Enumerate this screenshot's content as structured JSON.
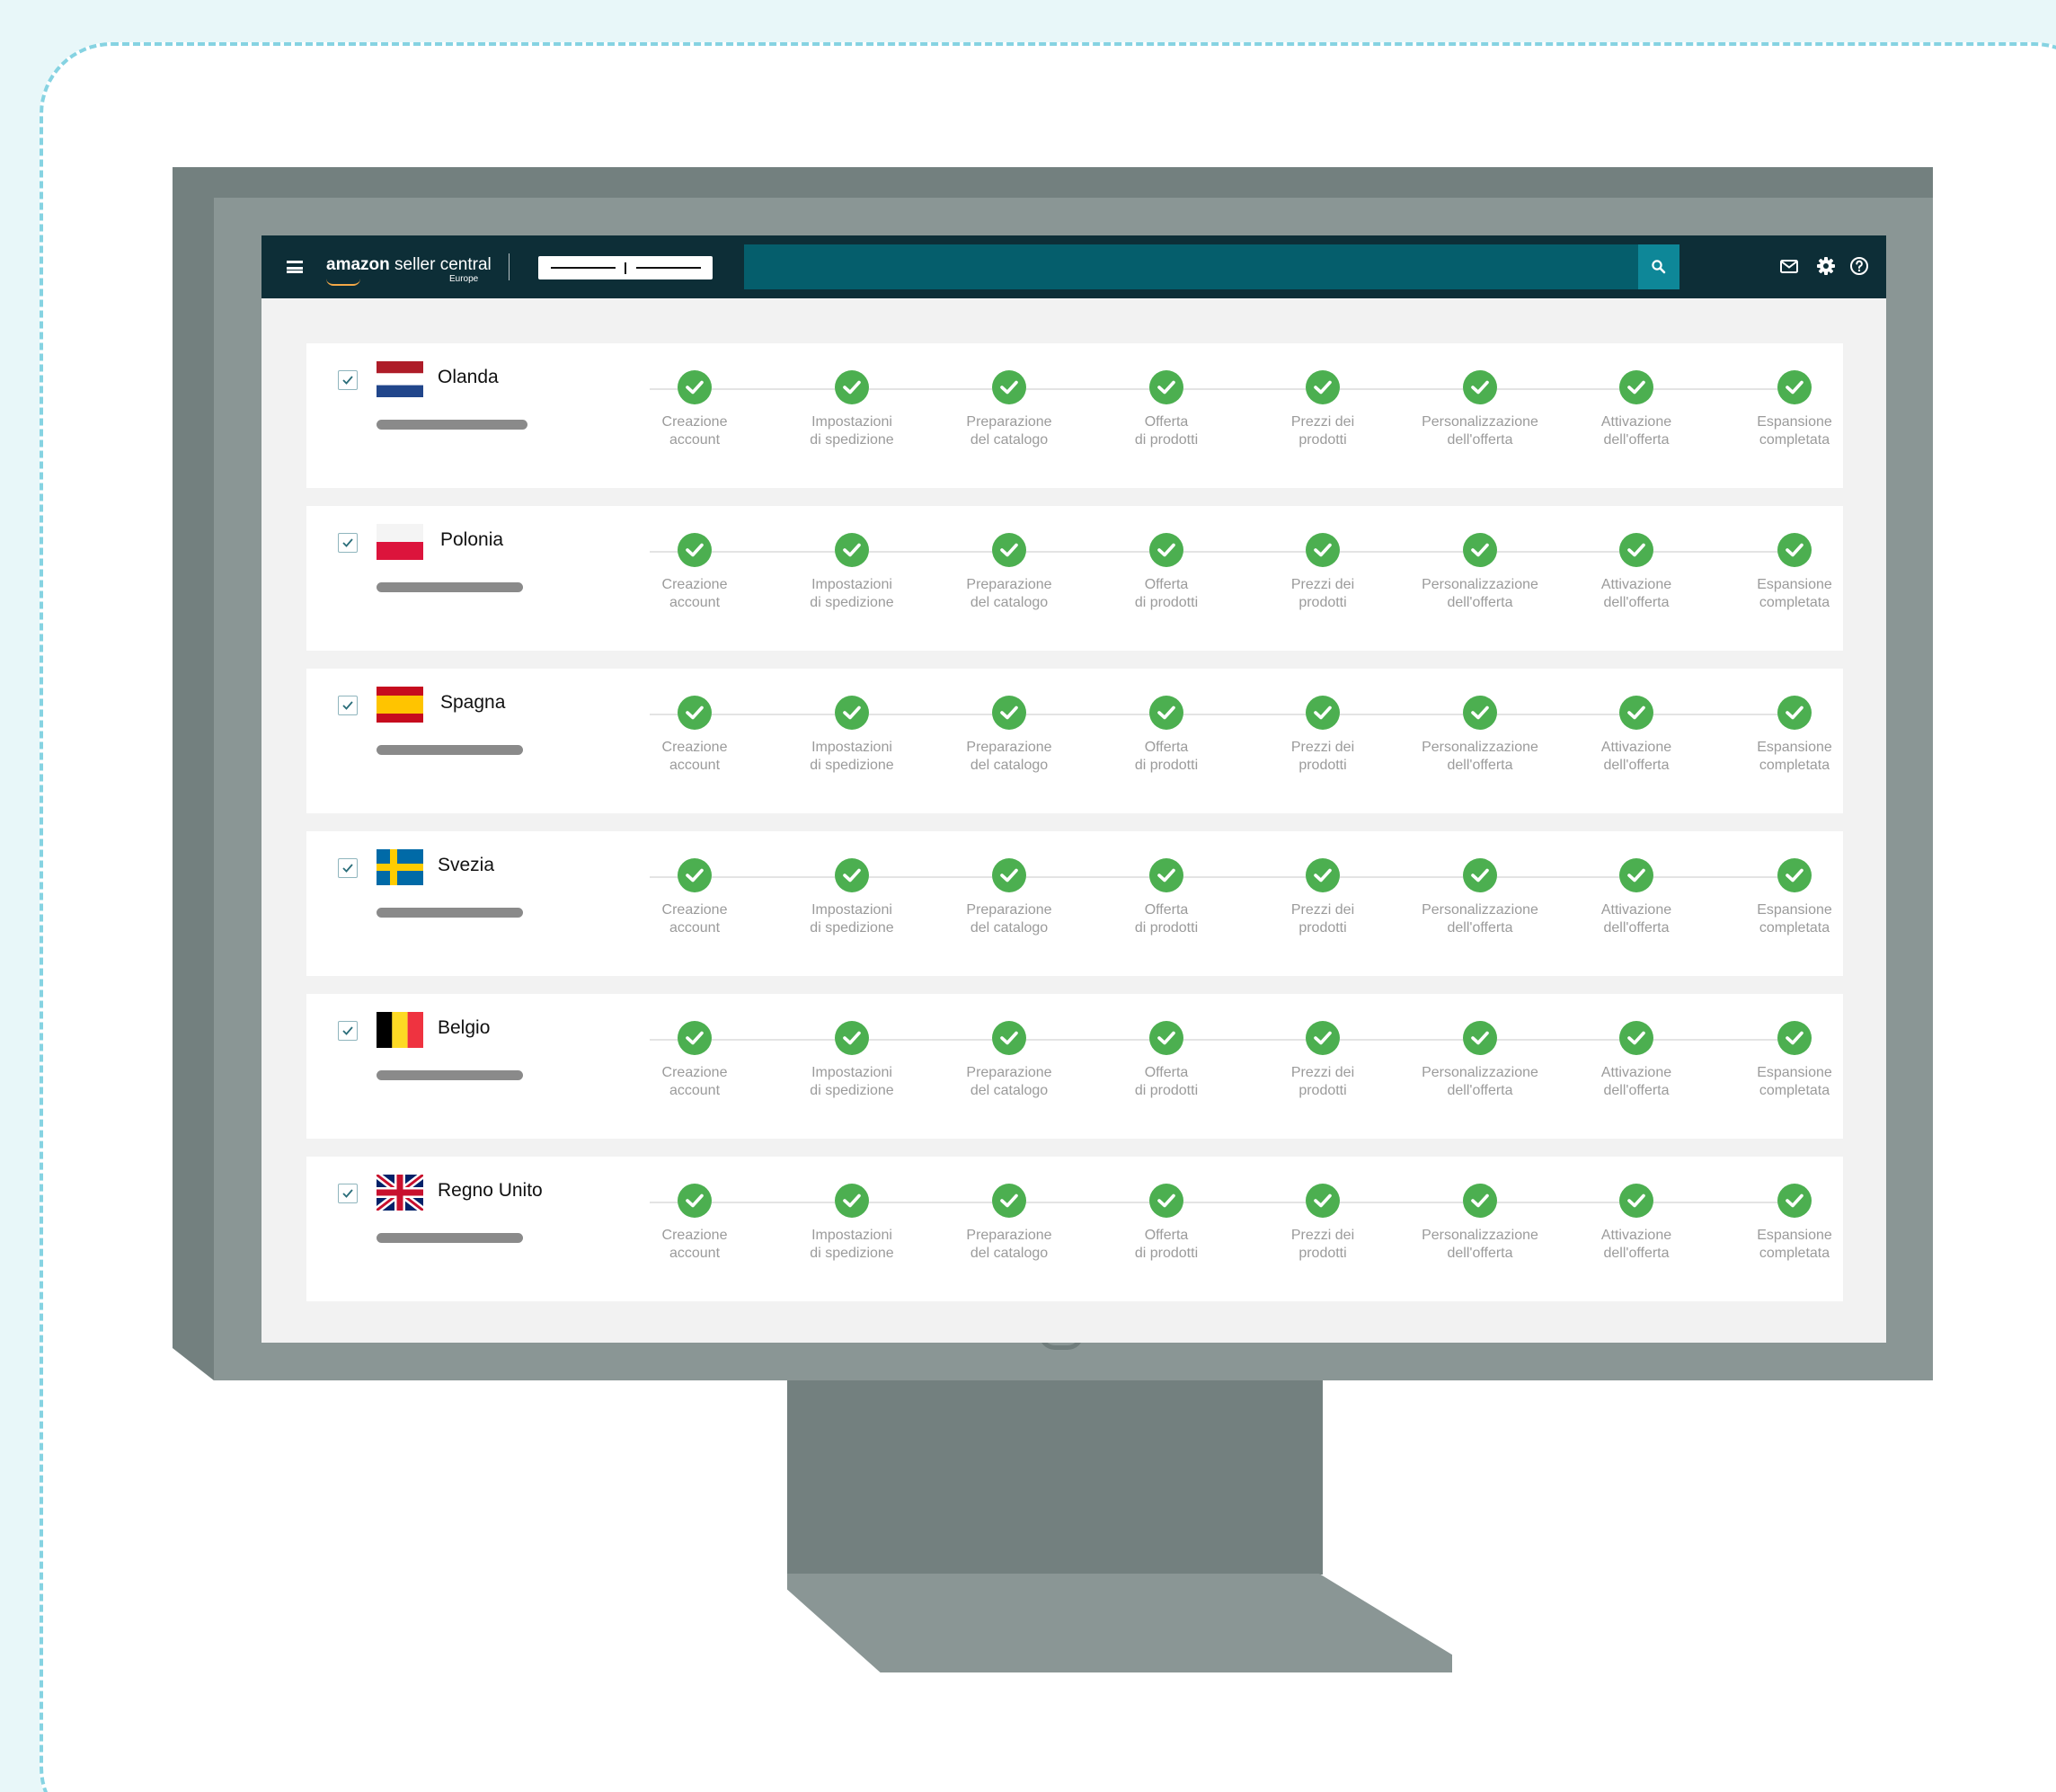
{
  "app": {
    "brand": "amazon",
    "product": " seller central",
    "region": "Europe"
  },
  "steps": [
    {
      "line1": "Creazione",
      "line2": "account"
    },
    {
      "line1": "Impostazioni",
      "line2": "di spedizione"
    },
    {
      "line1": "Preparazione",
      "line2": "del catalogo"
    },
    {
      "line1": "Offerta",
      "line2": "di prodotti"
    },
    {
      "line1": "Prezzi dei",
      "line2": "prodotti"
    },
    {
      "line1": "Personalizzazione",
      "line2": "dell'offerta"
    },
    {
      "line1": "Attivazione",
      "line2": "dell'offerta"
    },
    {
      "line1": "Espansione",
      "line2": "completata"
    }
  ],
  "countries": [
    {
      "name": "Olanda",
      "checked": true,
      "flag": "netherlands-flag",
      "completed_steps": 8
    },
    {
      "name": "Polonia",
      "checked": true,
      "flag": "poland-flag",
      "completed_steps": 8
    },
    {
      "name": "Spagna",
      "checked": true,
      "flag": "spain-flag",
      "completed_steps": 8
    },
    {
      "name": "Svezia",
      "checked": true,
      "flag": "sweden-flag",
      "completed_steps": 8
    },
    {
      "name": "Belgio",
      "checked": true,
      "flag": "belgium-flag",
      "completed_steps": 8
    },
    {
      "name": "Regno Unito",
      "checked": true,
      "flag": "uk-flag",
      "completed_steps": 8
    }
  ],
  "colors": {
    "topbar": "#0d2e37",
    "search": "#055e6c",
    "search_button": "#0e8798",
    "step_done": "#4caf50",
    "accent_border": "#86d3e2"
  }
}
